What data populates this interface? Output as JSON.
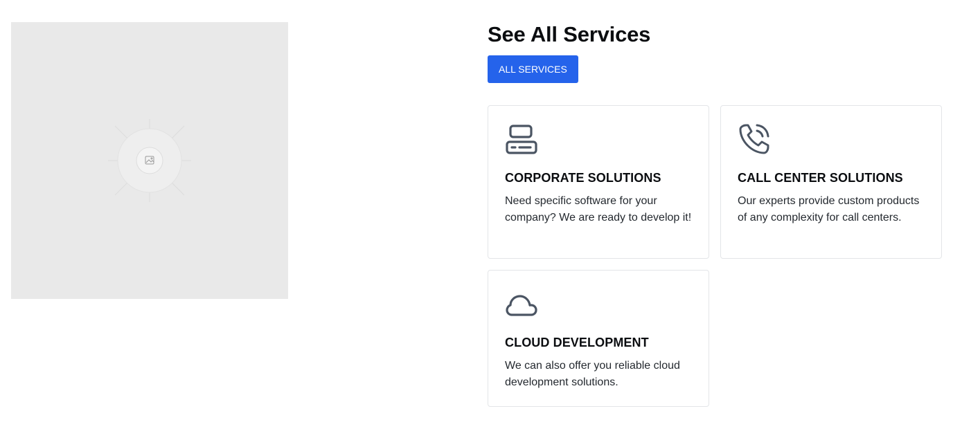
{
  "colors": {
    "accent": "#2563eb",
    "placeholder_bg": "#e9e9e9",
    "icon_stroke": "#4b5563",
    "card_border": "#e3e5e8"
  },
  "image": {
    "icon": "image-placeholder-icon"
  },
  "section": {
    "title": "See All Services",
    "button_label": "ALL SERVICES"
  },
  "services": [
    {
      "icon": "server-icon",
      "title": "CORPORATE SOLUTIONS",
      "description": "Need specific software for your company? We are ready to develop it!"
    },
    {
      "icon": "phone-call-icon",
      "title": "CALL CENTER SOLUTIONS",
      "description": "Our experts provide custom products of any complexity for call centers."
    },
    {
      "icon": "cloud-icon",
      "title": "CLOUD DEVELOPMENT",
      "description": "We can also offer you reliable cloud development solutions."
    }
  ]
}
